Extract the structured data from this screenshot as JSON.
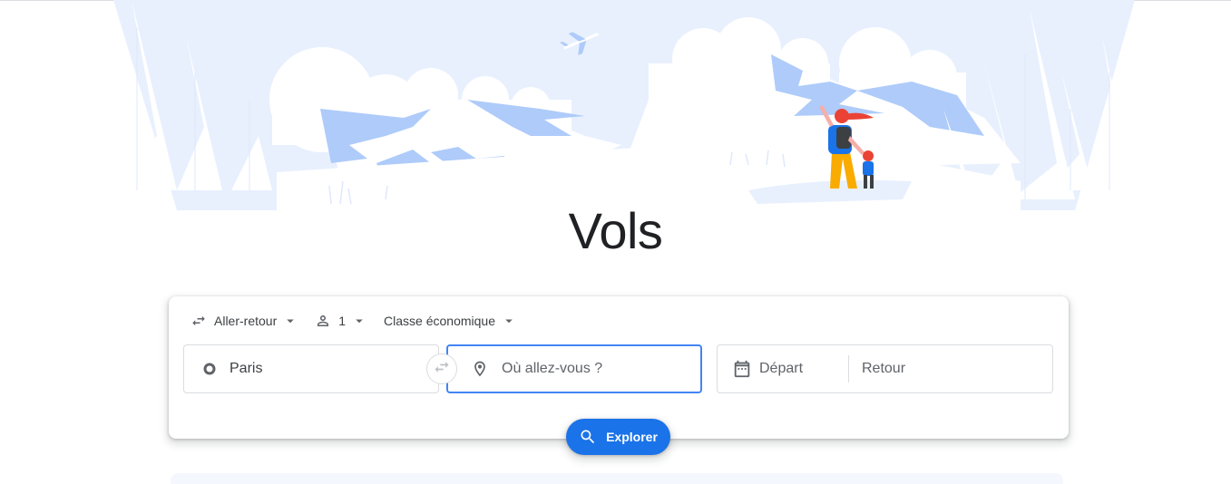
{
  "page": {
    "title": "Vols"
  },
  "options": {
    "trip_type": "Aller-retour",
    "passengers": "1",
    "cabin_class": "Classe économique"
  },
  "search": {
    "origin": "Paris",
    "destination_placeholder": "Où allez-vous ?",
    "departure_placeholder": "Départ",
    "return_placeholder": "Retour"
  },
  "actions": {
    "explore_label": "Explorer"
  },
  "colors": {
    "accent": "#1a73e8",
    "focus_border": "#4285f4",
    "sky": "#e8f0fe",
    "mountain": "#aecbfa"
  },
  "icons": {
    "trip_type": "swap-horizontal-icon",
    "passengers": "person-icon",
    "origin": "circle-icon",
    "destination": "location-pin-icon",
    "dates": "calendar-icon",
    "swap": "swap-arrows-icon",
    "explore": "search-icon",
    "dropdown": "chevron-down-icon"
  }
}
